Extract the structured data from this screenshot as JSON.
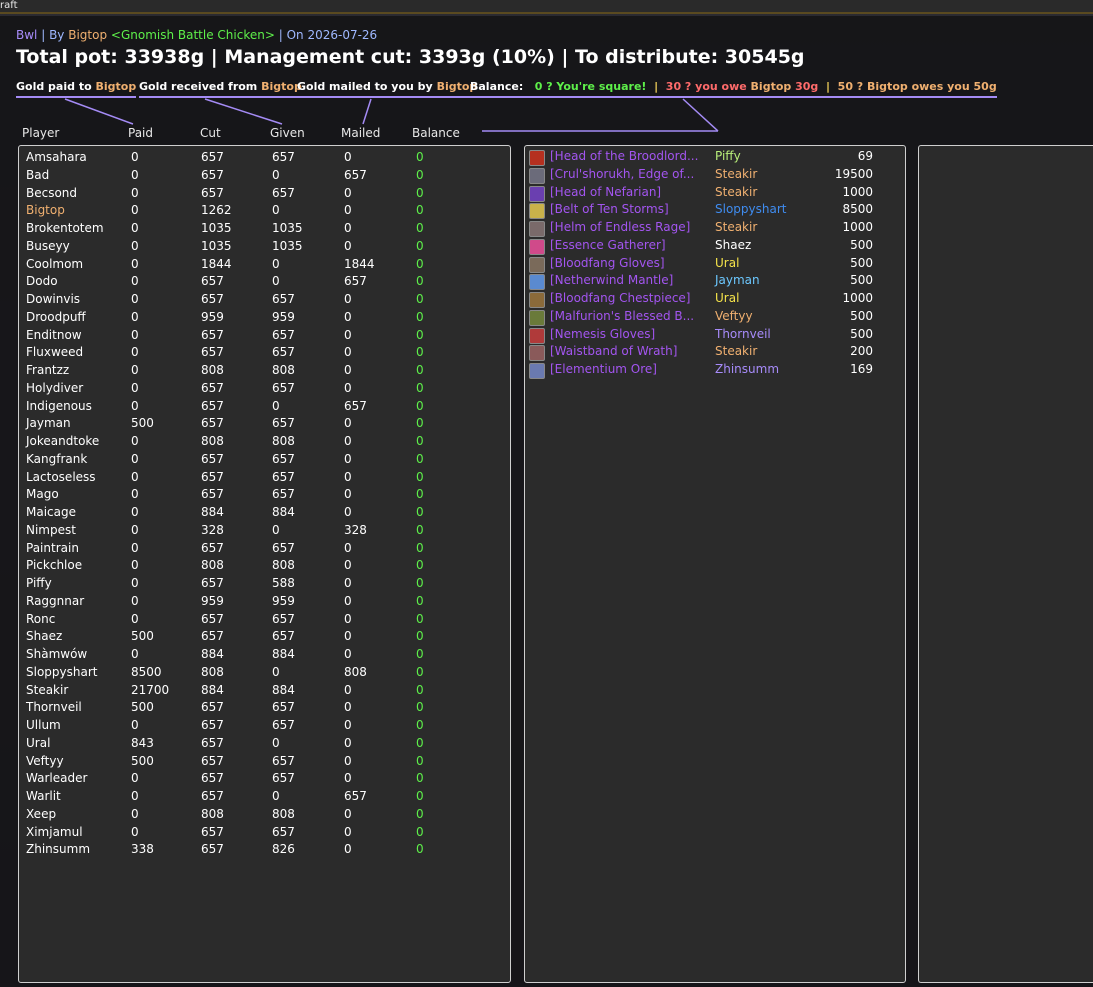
{
  "window": {
    "top_label": "raft"
  },
  "meta": {
    "raid": "Bwl",
    "by_prefix": " | By ",
    "author": "Bigtop",
    "guild": " <Gnomish Battle Chicken>",
    "date_prefix": " | On ",
    "date": "2026-07-26"
  },
  "summary": {
    "text": "Total pot: 33938g | Management cut: 3393g (10%) | To distribute: 30545g"
  },
  "legend": {
    "paid_label": "Gold paid to ",
    "paid_name": "Bigtop",
    "received_label": "Gold received from ",
    "received_name": "Bigtop",
    "mailed_label": "Gold mailed to you by ",
    "mailed_name": "Bigtop",
    "balance_label": "Balance:",
    "square": "0 ? You're square!",
    "sep": "|",
    "owe_prefix": "30 ? you owe ",
    "owe_name": "Bigtop",
    "owe_amount": "30g",
    "owes_prefix": "50 ? ",
    "owes_name": "Bigtop",
    "owes_suffix": " owes you 50g"
  },
  "columns": [
    "Player",
    "Paid",
    "Cut",
    "Given",
    "Mailed",
    "Balance"
  ],
  "colors": {
    "green": "#5ef04a",
    "orange": "#f0b070",
    "purple": "#a78bfa",
    "epic": "#a355f0",
    "yellow": "#f5d35a",
    "blue": "#3f8cf0",
    "cyan": "#6cc8ff"
  },
  "players": [
    {
      "name": "Amsahara",
      "paid": "0",
      "cut": "657",
      "given": "657",
      "mailed": "0",
      "balance": "0"
    },
    {
      "name": "Bad",
      "paid": "0",
      "cut": "657",
      "given": "0",
      "mailed": "657",
      "balance": "0"
    },
    {
      "name": "Becsond",
      "paid": "0",
      "cut": "657",
      "given": "657",
      "mailed": "0",
      "balance": "0"
    },
    {
      "name": "Bigtop",
      "paid": "0",
      "cut": "1262",
      "given": "0",
      "mailed": "0",
      "balance": "0",
      "highlight": true
    },
    {
      "name": "Brokentotem",
      "paid": "0",
      "cut": "1035",
      "given": "1035",
      "mailed": "0",
      "balance": "0"
    },
    {
      "name": "Buseyy",
      "paid": "0",
      "cut": "1035",
      "given": "1035",
      "mailed": "0",
      "balance": "0"
    },
    {
      "name": "Coolmom",
      "paid": "0",
      "cut": "1844",
      "given": "0",
      "mailed": "1844",
      "balance": "0"
    },
    {
      "name": "Dodo",
      "paid": "0",
      "cut": "657",
      "given": "0",
      "mailed": "657",
      "balance": "0"
    },
    {
      "name": "Dowinvis",
      "paid": "0",
      "cut": "657",
      "given": "657",
      "mailed": "0",
      "balance": "0"
    },
    {
      "name": "Droodpuff",
      "paid": "0",
      "cut": "959",
      "given": "959",
      "mailed": "0",
      "balance": "0"
    },
    {
      "name": "Enditnow",
      "paid": "0",
      "cut": "657",
      "given": "657",
      "mailed": "0",
      "balance": "0"
    },
    {
      "name": "Fluxweed",
      "paid": "0",
      "cut": "657",
      "given": "657",
      "mailed": "0",
      "balance": "0"
    },
    {
      "name": "Frantzz",
      "paid": "0",
      "cut": "808",
      "given": "808",
      "mailed": "0",
      "balance": "0"
    },
    {
      "name": "Holydiver",
      "paid": "0",
      "cut": "657",
      "given": "657",
      "mailed": "0",
      "balance": "0"
    },
    {
      "name": "Indigenous",
      "paid": "0",
      "cut": "657",
      "given": "0",
      "mailed": "657",
      "balance": "0"
    },
    {
      "name": "Jayman",
      "paid": "500",
      "cut": "657",
      "given": "657",
      "mailed": "0",
      "balance": "0"
    },
    {
      "name": "Jokeandtoke",
      "paid": "0",
      "cut": "808",
      "given": "808",
      "mailed": "0",
      "balance": "0"
    },
    {
      "name": "Kangfrank",
      "paid": "0",
      "cut": "657",
      "given": "657",
      "mailed": "0",
      "balance": "0"
    },
    {
      "name": "Lactoseless",
      "paid": "0",
      "cut": "657",
      "given": "657",
      "mailed": "0",
      "balance": "0"
    },
    {
      "name": "Mago",
      "paid": "0",
      "cut": "657",
      "given": "657",
      "mailed": "0",
      "balance": "0"
    },
    {
      "name": "Maicage",
      "paid": "0",
      "cut": "884",
      "given": "884",
      "mailed": "0",
      "balance": "0"
    },
    {
      "name": "Nimpest",
      "paid": "0",
      "cut": "328",
      "given": "0",
      "mailed": "328",
      "balance": "0"
    },
    {
      "name": "Paintrain",
      "paid": "0",
      "cut": "657",
      "given": "657",
      "mailed": "0",
      "balance": "0"
    },
    {
      "name": "Pickchloe",
      "paid": "0",
      "cut": "808",
      "given": "808",
      "mailed": "0",
      "balance": "0"
    },
    {
      "name": "Piffy",
      "paid": "0",
      "cut": "657",
      "given": "588",
      "mailed": "0",
      "balance": "0"
    },
    {
      "name": "Raggnnar",
      "paid": "0",
      "cut": "959",
      "given": "959",
      "mailed": "0",
      "balance": "0"
    },
    {
      "name": "Ronc",
      "paid": "0",
      "cut": "657",
      "given": "657",
      "mailed": "0",
      "balance": "0"
    },
    {
      "name": "Shaez",
      "paid": "500",
      "cut": "657",
      "given": "657",
      "mailed": "0",
      "balance": "0"
    },
    {
      "name": "Shàmwów",
      "paid": "0",
      "cut": "884",
      "given": "884",
      "mailed": "0",
      "balance": "0"
    },
    {
      "name": "Sloppyshart",
      "paid": "8500",
      "cut": "808",
      "given": "0",
      "mailed": "808",
      "balance": "0"
    },
    {
      "name": "Steakir",
      "paid": "21700",
      "cut": "884",
      "given": "884",
      "mailed": "0",
      "balance": "0"
    },
    {
      "name": "Thornveil",
      "paid": "500",
      "cut": "657",
      "given": "657",
      "mailed": "0",
      "balance": "0"
    },
    {
      "name": "Ullum",
      "paid": "0",
      "cut": "657",
      "given": "657",
      "mailed": "0",
      "balance": "0"
    },
    {
      "name": "Ural",
      "paid": "843",
      "cut": "657",
      "given": "0",
      "mailed": "0",
      "balance": "0"
    },
    {
      "name": "Veftyy",
      "paid": "500",
      "cut": "657",
      "given": "657",
      "mailed": "0",
      "balance": "0"
    },
    {
      "name": "Warleader",
      "paid": "0",
      "cut": "657",
      "given": "657",
      "mailed": "0",
      "balance": "0"
    },
    {
      "name": "Warlit",
      "paid": "0",
      "cut": "657",
      "given": "0",
      "mailed": "657",
      "balance": "0"
    },
    {
      "name": "Xeep",
      "paid": "0",
      "cut": "808",
      "given": "808",
      "mailed": "0",
      "balance": "0"
    },
    {
      "name": "Ximjamul",
      "paid": "0",
      "cut": "657",
      "given": "657",
      "mailed": "0",
      "balance": "0"
    },
    {
      "name": "Zhinsumm",
      "paid": "338",
      "cut": "657",
      "given": "826",
      "mailed": "0",
      "balance": "0"
    }
  ],
  "loot": [
    {
      "item": "[Head of the Broodlord...",
      "winner": "Piffy",
      "winner_color": "#b9f07a",
      "price": "69",
      "icon_color": "#b5301f"
    },
    {
      "item": "[Crul'shorukh, Edge of...",
      "winner": "Steakir",
      "winner_color": "#f0b070",
      "price": "19500",
      "icon_color": "#6b6b7a"
    },
    {
      "item": "[Head of Nefarian]",
      "winner": "Steakir",
      "winner_color": "#f0b070",
      "price": "1000",
      "icon_color": "#6a3fb0"
    },
    {
      "item": "[Belt of Ten Storms]",
      "winner": "Sloppyshart",
      "winner_color": "#3f8cf0",
      "price": "8500",
      "icon_color": "#c9b24a"
    },
    {
      "item": "[Helm of Endless Rage]",
      "winner": "Steakir",
      "winner_color": "#f0b070",
      "price": "1000",
      "icon_color": "#7a6a6a"
    },
    {
      "item": "[Essence Gatherer]",
      "winner": "Shaez",
      "winner_color": "#ffffff",
      "price": "500",
      "icon_color": "#d04a8a"
    },
    {
      "item": "[Bloodfang Gloves]",
      "winner": "Ural",
      "winner_color": "#f5e34a",
      "price": "500",
      "icon_color": "#7a6a5a"
    },
    {
      "item": "[Netherwind Mantle]",
      "winner": "Jayman",
      "winner_color": "#6cc8ff",
      "price": "500",
      "icon_color": "#5a8ad0"
    },
    {
      "item": "[Bloodfang Chestpiece]",
      "winner": "Ural",
      "winner_color": "#f5e34a",
      "price": "1000",
      "icon_color": "#8a6a3a"
    },
    {
      "item": "[Malfurion's Blessed B...",
      "winner": "Veftyy",
      "winner_color": "#f0b070",
      "price": "500",
      "icon_color": "#6a7a3a"
    },
    {
      "item": "[Nemesis Gloves]",
      "winner": "Thornveil",
      "winner_color": "#a78bfa",
      "price": "500",
      "icon_color": "#b03a3a"
    },
    {
      "item": "[Waistband of Wrath]",
      "winner": "Steakir",
      "winner_color": "#f0b070",
      "price": "200",
      "icon_color": "#8a5a5a"
    },
    {
      "item": "[Elementium Ore]",
      "winner": "Zhinsumm",
      "winner_color": "#a78bfa",
      "price": "169",
      "icon_color": "#6a7ab0"
    }
  ]
}
